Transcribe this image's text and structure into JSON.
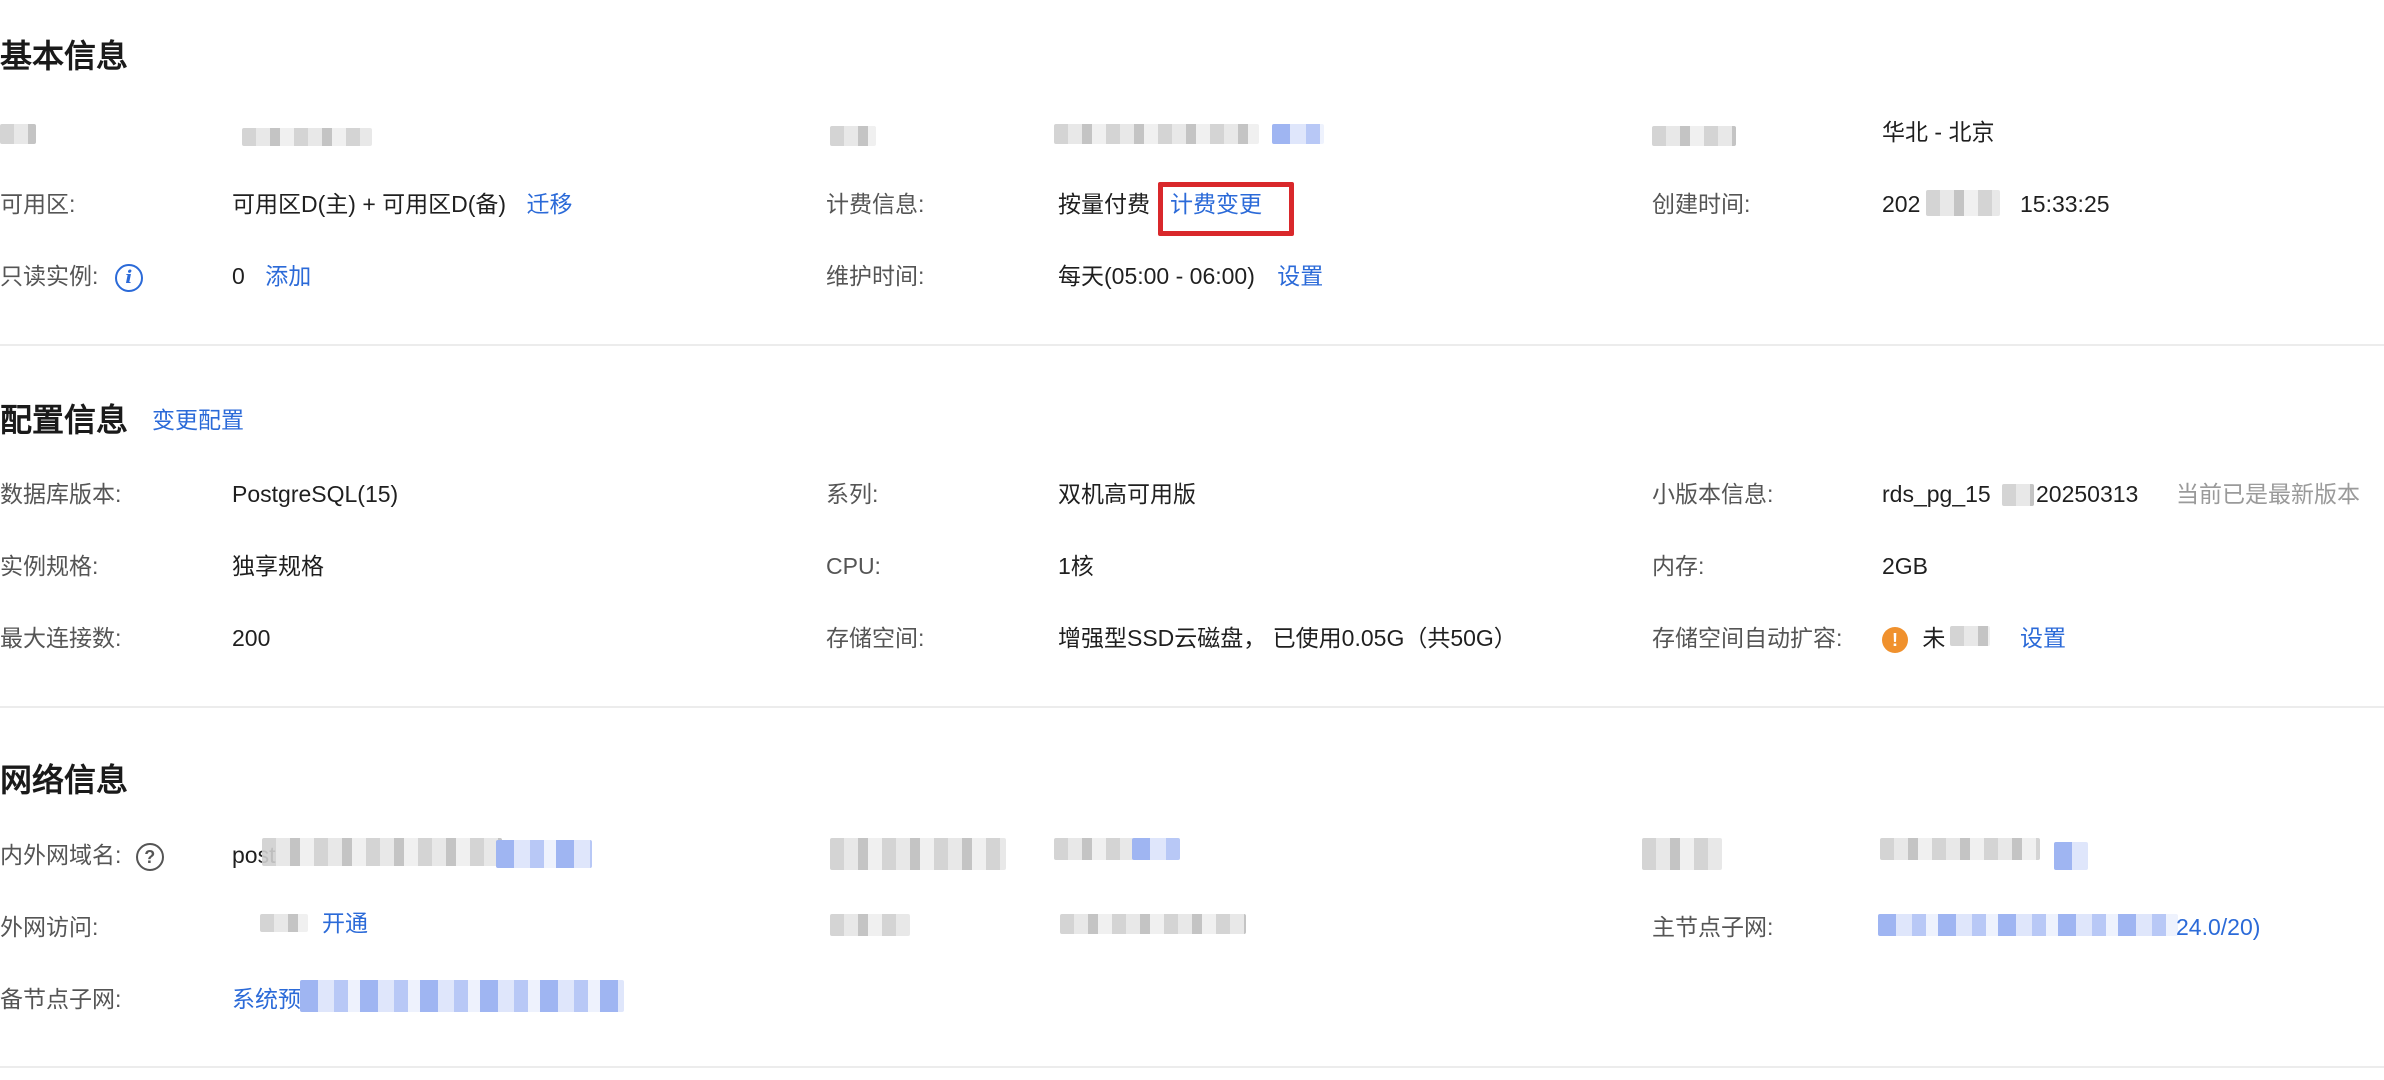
{
  "basic": {
    "title": "基本信息",
    "row1": {
      "col3_value": "华北 - 北京"
    },
    "zone": {
      "label": "可用区:",
      "value": "可用区D(主) + 可用区D(备)",
      "action": "迁移"
    },
    "billing": {
      "label": "计费信息:",
      "value": "按量付费",
      "action": "计费变更"
    },
    "created": {
      "label": "创建时间:",
      "value_start": "202",
      "value_end": "15:33:25"
    },
    "readonly": {
      "label": "只读实例:",
      "icon": "info-icon",
      "count": "0",
      "action": "添加"
    },
    "maintenance": {
      "label": "维护时间:",
      "value": "每天(05:00 - 06:00)",
      "action": "设置"
    }
  },
  "config": {
    "title": "配置信息",
    "action": "变更配置",
    "db_version": {
      "label": "数据库版本:",
      "value": "PostgreSQL(15)"
    },
    "series": {
      "label": "系列:",
      "value": "双机高可用版"
    },
    "minor_version": {
      "label": "小版本信息:",
      "value_start": "rds_pg_15",
      "value_end": "20250313",
      "note": "当前已是最新版本"
    },
    "spec": {
      "label": "实例规格:",
      "value": "独享规格"
    },
    "cpu": {
      "label": "CPU:",
      "value": "1核"
    },
    "memory": {
      "label": "内存:",
      "value": "2GB"
    },
    "max_conn": {
      "label": "最大连接数:",
      "value": "200"
    },
    "storage": {
      "label": "存储空间:",
      "value": "增强型SSD云磁盘， 已使用0.05G（共50G）"
    },
    "auto_expand": {
      "label": "存储空间自动扩容:",
      "icon": "warning-icon",
      "value": "未",
      "action": "设置"
    }
  },
  "network": {
    "title": "网络信息",
    "domain": {
      "label": "内外网域名:",
      "icon": "help-icon",
      "value_start": "post"
    },
    "public": {
      "label": "外网访问:",
      "action": "开通"
    },
    "primary_subnet": {
      "label": "主节点子网:",
      "value_end": "24.0/20)"
    },
    "standby_subnet": {
      "label": "备节点子网:",
      "value_start": "系统预"
    }
  },
  "colors": {
    "link": "#2b6ad8",
    "highlight": "#d9282b",
    "warning": "#f0912d"
  }
}
